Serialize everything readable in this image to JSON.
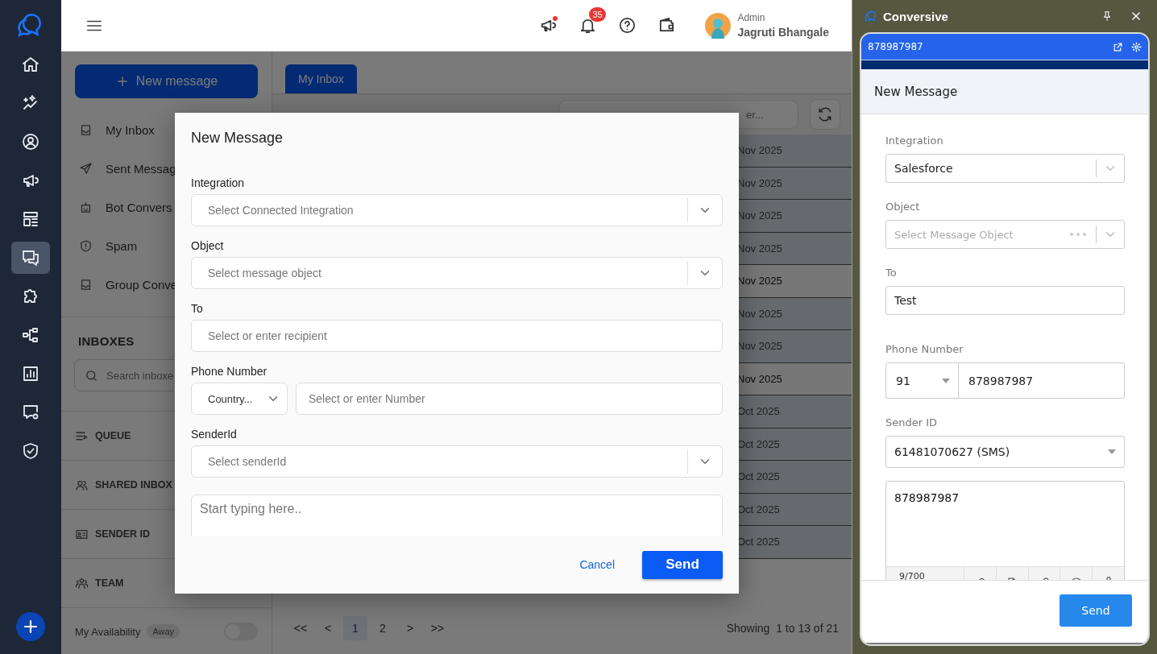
{
  "rail": {
    "items": [
      {
        "kind": "home",
        "selected": false
      },
      {
        "kind": "sparkle",
        "selected": false
      },
      {
        "kind": "user",
        "selected": false
      },
      {
        "kind": "megaphone",
        "selected": false
      },
      {
        "kind": "layout",
        "selected": false
      },
      {
        "kind": "chat",
        "selected": true
      },
      {
        "kind": "puzzle",
        "selected": false
      },
      {
        "kind": "flow",
        "selected": false
      },
      {
        "kind": "chart",
        "selected": false
      },
      {
        "kind": "chatgear",
        "selected": false
      },
      {
        "kind": "shield",
        "selected": false
      }
    ]
  },
  "topbar": {
    "notifications_badge": "35",
    "user": {
      "role": "Admin",
      "name": "Jagruti Bhangale"
    }
  },
  "sidebar": {
    "new_message_button": "New message",
    "nav": [
      {
        "label": "My Inbox",
        "kind": "inbox"
      },
      {
        "label": "Sent Messag",
        "kind": "send"
      },
      {
        "label": "Bot Convers",
        "kind": "bot"
      },
      {
        "label": "Spam",
        "kind": "spam"
      },
      {
        "label": "Group Conve",
        "kind": "inbox"
      }
    ],
    "inboxes_title": "INBOXES",
    "inbox_search": {
      "placeholder": "Search inboxe"
    },
    "sections": [
      {
        "label": "QUEUE",
        "kind": "queue"
      },
      {
        "label": "SHARED INBOX",
        "kind": "users"
      },
      {
        "label": "SENDER ID",
        "kind": "idcard"
      },
      {
        "label": "TEAM",
        "kind": "team"
      }
    ],
    "availability": {
      "label": "My Availability",
      "status": "Away",
      "on": false
    }
  },
  "content": {
    "tabs": [
      {
        "label": "My Inbox",
        "selected": true
      }
    ],
    "search": {
      "placeholder": "er..."
    },
    "rows": [
      {
        "date": "Nov 2025",
        "unread": false
      },
      {
        "date": "Nov 2025",
        "unread": false
      },
      {
        "date": "Nov 2025",
        "unread": false
      },
      {
        "date": "Nov 2025",
        "unread": false
      },
      {
        "date": "Nov 2025",
        "unread": true
      },
      {
        "date": "Nov 2025",
        "unread": false
      },
      {
        "date": "Nov 2025",
        "unread": false
      },
      {
        "date": "Nov 2025",
        "unread": true
      },
      {
        "date": "Oct 2025",
        "unread": false
      },
      {
        "date": "Oct 2025",
        "unread": false
      },
      {
        "date": "Oct 2025",
        "unread": false
      },
      {
        "date": "Oct 2025",
        "unread": false
      },
      {
        "date": "Oct 2025",
        "unread": false
      }
    ],
    "pagination": {
      "pages": [
        {
          "label": "<<",
          "selected": false
        },
        {
          "label": "<",
          "selected": false
        },
        {
          "label": "1",
          "selected": true
        },
        {
          "label": "2",
          "selected": false
        },
        {
          "label": ">",
          "selected": false
        },
        {
          "label": ">>",
          "selected": false
        }
      ],
      "summary": "Showing  1 to 13 of 21"
    }
  },
  "modal": {
    "title": "New Message",
    "fields": [
      {
        "label": "Integration",
        "kind": "select",
        "placeholder": "Select Connected Integration"
      },
      {
        "label": "Object",
        "kind": "select",
        "placeholder": "Select message object"
      },
      {
        "label": "To",
        "kind": "input",
        "placeholder": "Select or enter recipient"
      },
      {
        "label": "Phone Number",
        "kind": "phone",
        "country_placeholder": "Country...",
        "placeholder": "Select or enter Number"
      },
      {
        "label": "SenderId",
        "kind": "select",
        "placeholder": "Select senderId"
      }
    ],
    "message": {
      "placeholder": "Start typing here.."
    },
    "cancel": "Cancel",
    "send": "Send"
  },
  "widget": {
    "app_title": "Conversive",
    "header": "878987987",
    "title": "New Message",
    "fields": [
      {
        "label": "Integration",
        "kind": "select",
        "value": "Salesforce"
      },
      {
        "label": "Object",
        "kind": "loading",
        "placeholder": "Select Message Object"
      },
      {
        "label": "To",
        "kind": "input",
        "value": "Test"
      },
      {
        "label": "Phone Number",
        "kind": "phone",
        "code": "91",
        "value": "878987987"
      },
      {
        "label": "Sender ID",
        "kind": "dropdown",
        "value": "61481070627 (SMS)"
      }
    ],
    "message": {
      "value": "878987987",
      "counter": "9/700"
    },
    "send": "Send"
  }
}
